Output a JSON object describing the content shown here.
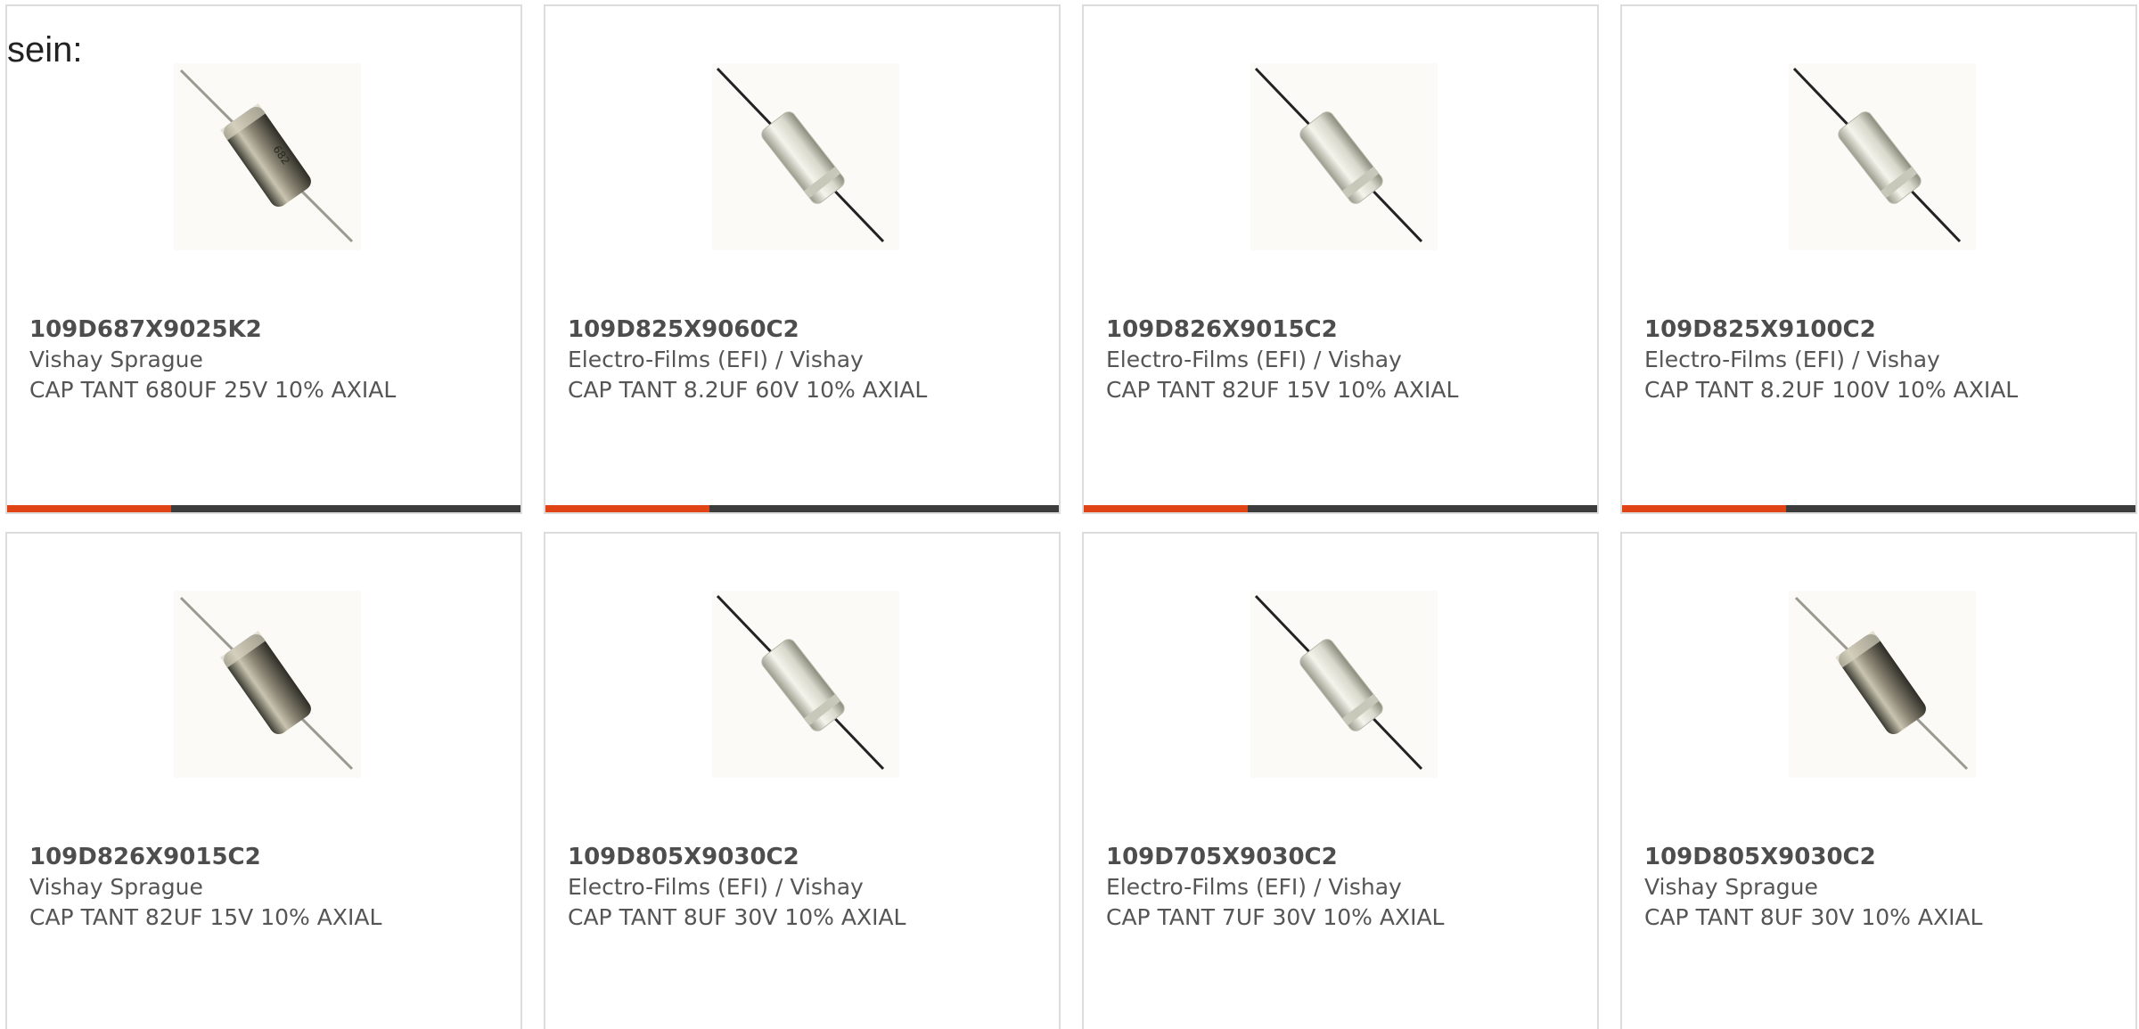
{
  "lead_text": "sein:",
  "colors": {
    "accent": "#e04414",
    "bar_track": "#3c3c3c",
    "card_border": "#dcdcdc"
  },
  "products": [
    {
      "part_number": "109D687X9025K2",
      "manufacturer": "Vishay Sprague",
      "description": "CAP TANT 680UF 25V 10% AXIAL",
      "image_icon": "capacitor-sprague-icon",
      "progress": 0.32
    },
    {
      "part_number": "109D825X9060C2",
      "manufacturer": "Electro-Films (EFI) / Vishay",
      "description": "CAP TANT 8.2UF 60V 10% AXIAL",
      "image_icon": "capacitor-efi-icon",
      "progress": 0.32
    },
    {
      "part_number": "109D826X9015C2",
      "manufacturer": "Electro-Films (EFI) / Vishay",
      "description": "CAP TANT 82UF 15V 10% AXIAL",
      "image_icon": "capacitor-efi-icon",
      "progress": 0.32
    },
    {
      "part_number": "109D825X9100C2",
      "manufacturer": "Electro-Films (EFI) / Vishay",
      "description": "CAP TANT 8.2UF 100V 10% AXIAL",
      "image_icon": "capacitor-efi-icon",
      "progress": 0.32
    },
    {
      "part_number": "109D826X9015C2",
      "manufacturer": "Vishay Sprague",
      "description": "CAP TANT 82UF 15V 10% AXIAL",
      "image_icon": "capacitor-sprague-icon"
    },
    {
      "part_number": "109D805X9030C2",
      "manufacturer": "Electro-Films (EFI) / Vishay",
      "description": "CAP TANT 8UF 30V 10% AXIAL",
      "image_icon": "capacitor-efi-icon"
    },
    {
      "part_number": "109D705X9030C2",
      "manufacturer": "Electro-Films (EFI) / Vishay",
      "description": "CAP TANT 7UF 30V 10% AXIAL",
      "image_icon": "capacitor-efi-icon"
    },
    {
      "part_number": "109D805X9030C2",
      "manufacturer": "Vishay Sprague",
      "description": "CAP TANT 8UF 30V 10% AXIAL",
      "image_icon": "capacitor-sprague-icon"
    }
  ]
}
